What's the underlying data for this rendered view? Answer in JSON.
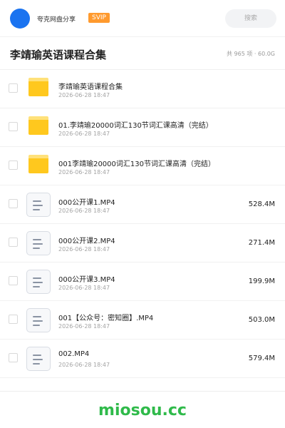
{
  "header": {
    "share_name": "夸克网盘分享",
    "badge": "SVIP",
    "search_placeholder": "搜索"
  },
  "page": {
    "title": "李靖瑜英语课程合集",
    "summary": "共 965 项 · 60.0G"
  },
  "files": [
    {
      "type": "folder",
      "name": "李靖瑜英语课程合集",
      "date": "2026-06-28 18:47",
      "size": ""
    },
    {
      "type": "folder",
      "name": "01.李靖瑜20000词汇130节词汇课高清（完结）",
      "date": "2026-06-28 18:47",
      "size": ""
    },
    {
      "type": "folder",
      "name": "001李靖瑜20000词汇130节词汇课高清（完结）",
      "date": "2026-06-28 18:47",
      "size": ""
    },
    {
      "type": "file",
      "name": "000公开课1.MP4",
      "date": "2026-06-28 18:47",
      "size": "528.4M"
    },
    {
      "type": "file",
      "name": "000公开课2.MP4",
      "date": "2026-06-28 18:47",
      "size": "271.4M"
    },
    {
      "type": "file",
      "name": "000公开课3.MP4",
      "date": "2026-06-28 18:47",
      "size": "199.9M"
    },
    {
      "type": "file",
      "name": "001【公众号：密知圈】.MP4",
      "date": "2026-06-28 18:47",
      "size": "503.0M"
    },
    {
      "type": "file",
      "name": "002.MP4",
      "date": "2026-06-28 18:47",
      "size": "579.4M"
    }
  ],
  "footer": {
    "watermark": "miosou.cc"
  },
  "colors": {
    "accent": "#1a73f0",
    "badge": "#ff9a2e",
    "folder": "#ffc81e",
    "watermark": "#2fba4a"
  }
}
